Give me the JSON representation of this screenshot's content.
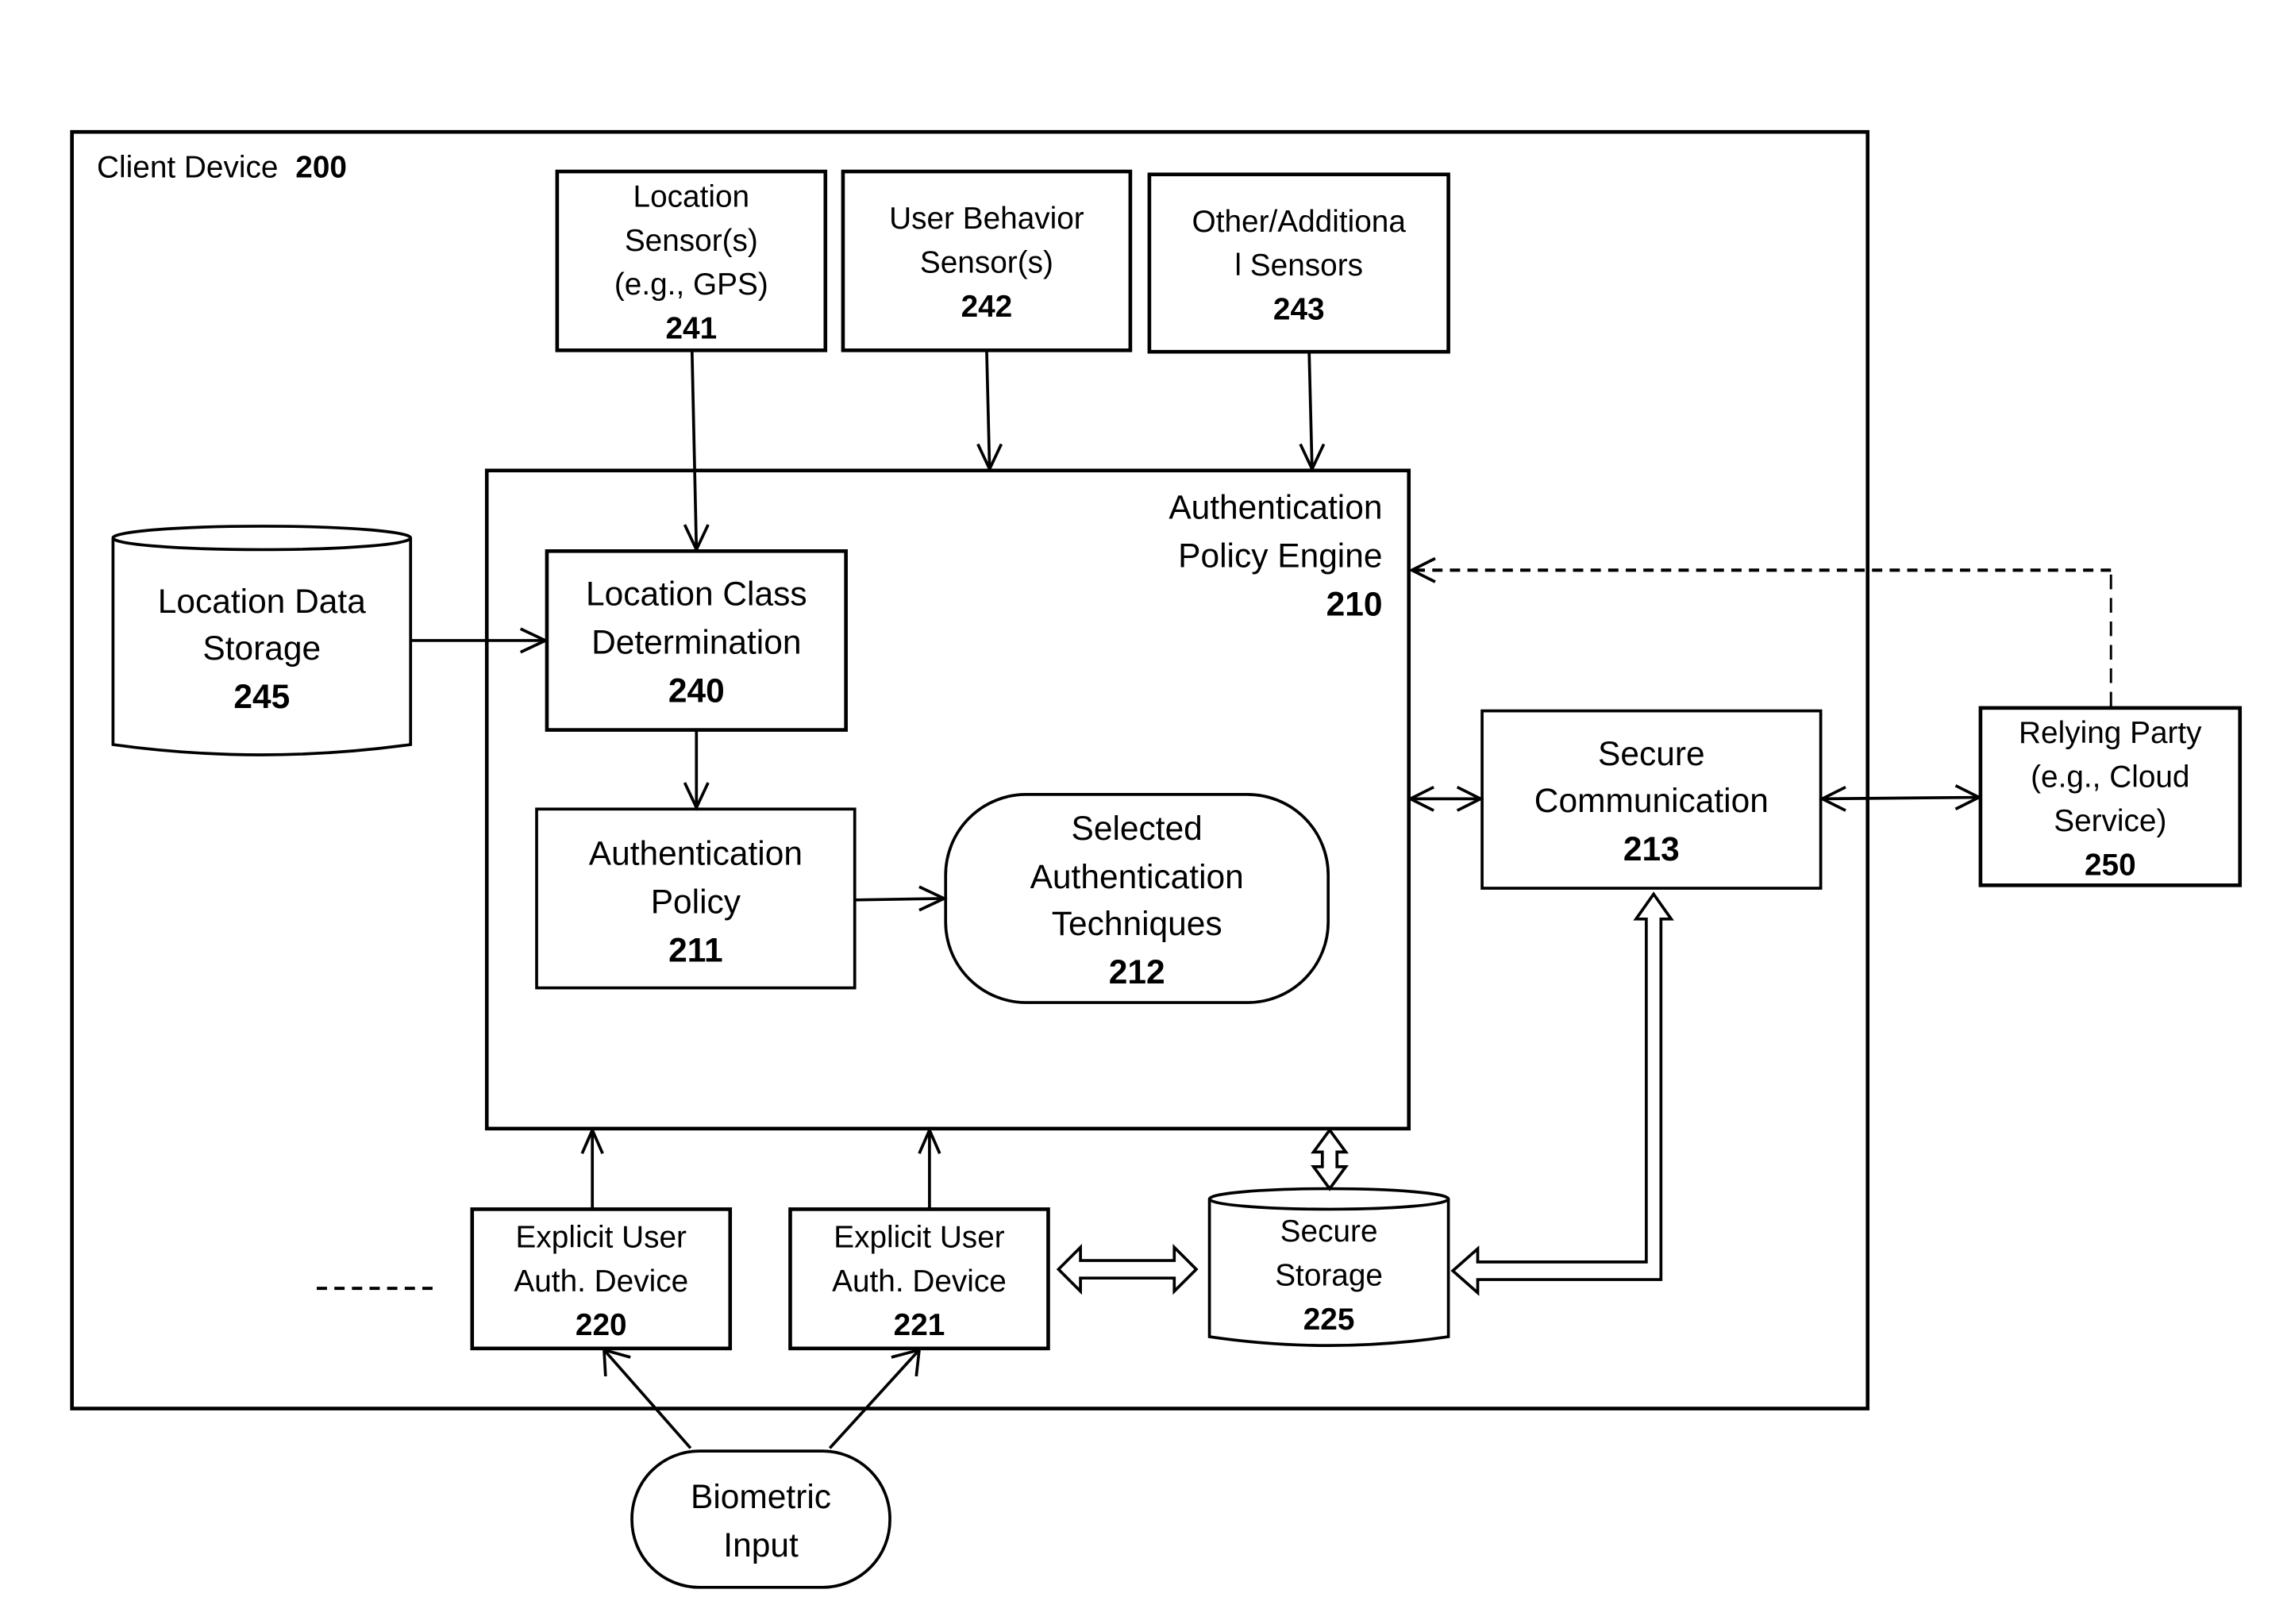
{
  "diagram": {
    "container": {
      "label": "Client Device",
      "ref": "200"
    },
    "sensors": [
      {
        "lines": [
          "Location",
          "Sensor(s)",
          "(e.g., GPS)"
        ],
        "ref": "241"
      },
      {
        "lines": [
          "User Behavior",
          "Sensor(s)"
        ],
        "ref": "242"
      },
      {
        "lines": [
          "Other/Additiona",
          "l Sensors"
        ],
        "ref": "243"
      }
    ],
    "engine": {
      "lines": [
        "Authentication",
        "Policy Engine"
      ],
      "ref": "210"
    },
    "location_storage": {
      "lines": [
        "Location Data",
        "Storage"
      ],
      "ref": "245"
    },
    "location_class": {
      "lines": [
        "Location Class",
        "Determination"
      ],
      "ref": "240"
    },
    "auth_policy": {
      "lines": [
        "Authentication",
        "Policy"
      ],
      "ref": "211"
    },
    "selected_techniques": {
      "lines": [
        "Selected",
        "Authentication",
        "Techniques"
      ],
      "ref": "212"
    },
    "secure_comm": {
      "lines": [
        "Secure",
        "Communication"
      ],
      "ref": "213"
    },
    "relying_party": {
      "lines": [
        "Relying Party",
        "(e.g., Cloud",
        "Service)"
      ],
      "ref": "250"
    },
    "auth_devices": [
      {
        "lines": [
          "Explicit User",
          "Auth. Device"
        ],
        "ref": "220"
      },
      {
        "lines": [
          "Explicit User",
          "Auth. Device"
        ],
        "ref": "221"
      }
    ],
    "secure_storage": {
      "lines": [
        "Secure",
        "Storage"
      ],
      "ref": "225"
    },
    "biometric": {
      "lines": [
        "Biometric",
        "Input"
      ]
    }
  }
}
